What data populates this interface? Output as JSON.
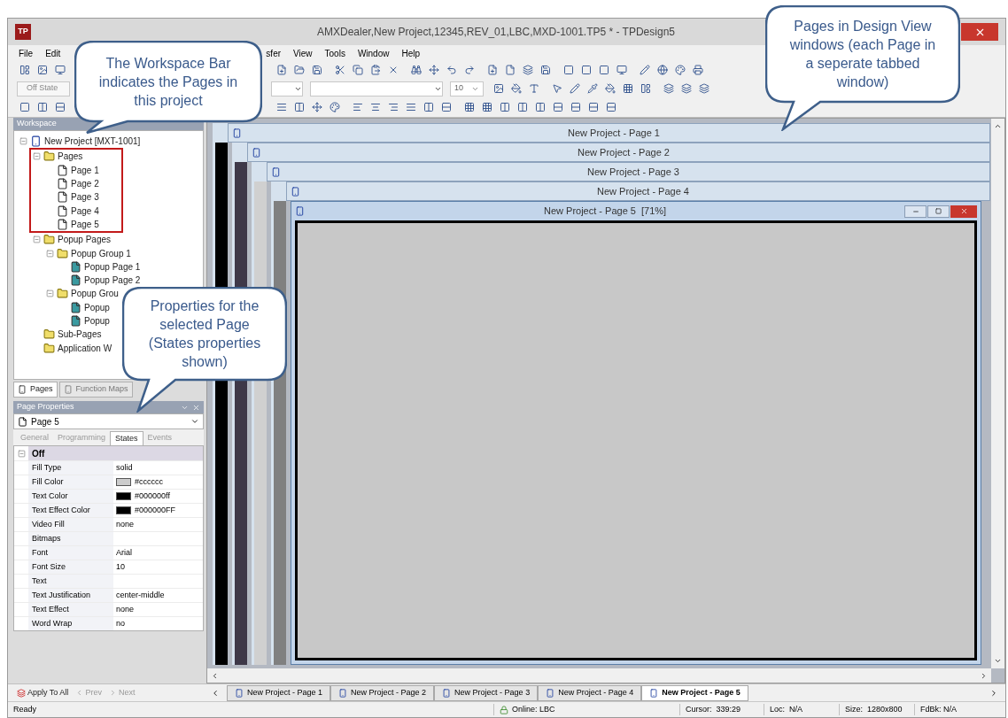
{
  "window": {
    "title": "AMXDealer,New Project,12345,REV_01,LBC,MXD-1001.TP5 * - TPDesign5",
    "logo": "TP"
  },
  "menu": [
    "File",
    "Edit",
    "sfer",
    "View",
    "Tools",
    "Window",
    "Help"
  ],
  "toolbar": {
    "state_combo": "Off State",
    "font_size": "10"
  },
  "workspace": {
    "title": "Workspace",
    "tree": [
      {
        "label": "New Project [MXT-1001]",
        "kind": "project",
        "expanded": true,
        "children": [
          {
            "label": "Pages",
            "kind": "folder",
            "expanded": true,
            "highlighted": true,
            "children": [
              {
                "label": "Page 1",
                "kind": "page"
              },
              {
                "label": "Page 2",
                "kind": "page"
              },
              {
                "label": "Page 3",
                "kind": "page"
              },
              {
                "label": "Page 4",
                "kind": "page"
              },
              {
                "label": "Page 5",
                "kind": "page"
              }
            ]
          },
          {
            "label": "Popup Pages",
            "kind": "folder",
            "expanded": true,
            "highlighted": false,
            "children": [
              {
                "label": "Popup Group 1",
                "kind": "folder",
                "expanded": true,
                "children": [
                  {
                    "label": "Popup Page 1",
                    "kind": "popup"
                  },
                  {
                    "label": "Popup Page 2",
                    "kind": "popup"
                  }
                ]
              },
              {
                "label": "Popup Grou",
                "kind": "folder",
                "expanded": true,
                "children": [
                  {
                    "label": "Popup",
                    "kind": "popup"
                  },
                  {
                    "label": "Popup",
                    "kind": "popup"
                  }
                ]
              }
            ]
          },
          {
            "label": "Sub-Pages",
            "kind": "folder",
            "highlighted": false
          },
          {
            "label": "Application W",
            "kind": "folder",
            "highlighted": false
          }
        ]
      }
    ],
    "tabs": [
      {
        "label": "Pages",
        "selected": true
      },
      {
        "label": "Function Maps",
        "selected": false
      }
    ]
  },
  "properties": {
    "title": "Page Properties",
    "selector": "Page 5",
    "tabs": [
      {
        "label": "General",
        "selected": false
      },
      {
        "label": "Programming",
        "selected": false
      },
      {
        "label": "States",
        "selected": true
      },
      {
        "label": "Events",
        "selected": false
      }
    ],
    "group": {
      "label": "Off",
      "expanded": true
    },
    "rows": [
      {
        "name": "Fill Type",
        "value": "solid"
      },
      {
        "name": "Fill Color",
        "value": "#cccccc",
        "color": "#cccccc"
      },
      {
        "name": "Text Color",
        "value": "#000000ff",
        "color": "#000000"
      },
      {
        "name": "Text Effect Color",
        "value": "#000000FF",
        "color": "#000000"
      },
      {
        "name": "Video Fill",
        "value": "none"
      },
      {
        "name": "Bitmaps"
      },
      {
        "name": "Font",
        "value": "Arial"
      },
      {
        "name": "Font Size",
        "value": "10"
      },
      {
        "name": "Text"
      },
      {
        "name": "Text Justification",
        "value": "center-middle"
      },
      {
        "name": "Text Effect",
        "value": "none"
      },
      {
        "name": "Word Wrap",
        "value": "no"
      }
    ]
  },
  "footer_buttons": [
    {
      "label": "Apply To All",
      "disabled": false
    },
    {
      "label": "Prev",
      "disabled": true
    },
    {
      "label": "Next",
      "disabled": true
    }
  ],
  "mdi_windows": [
    {
      "title": "New Project - Page 1",
      "active": false,
      "color": "#000000"
    },
    {
      "title": "New Project - Page 2",
      "active": false,
      "color": "#3e3848"
    },
    {
      "title": "New Project - Page 3",
      "active": false,
      "color": "#d0d0d0"
    },
    {
      "title": "New Project - Page 4",
      "active": false,
      "color": "#808080"
    },
    {
      "title": "New Project - Page 5  [71%]",
      "active": true,
      "color": "#c8c8c8"
    }
  ],
  "document_tabs": [
    {
      "label": "New Project - Page 1",
      "selected": false
    },
    {
      "label": "New Project - Page 2",
      "selected": false
    },
    {
      "label": "New Project - Page 3",
      "selected": false
    },
    {
      "label": "New Project - Page 4",
      "selected": false
    },
    {
      "label": "New Project - Page 5",
      "selected": true
    }
  ],
  "status_bar": {
    "ready": "Ready",
    "online": "Online: LBC",
    "cursor": "Cursor:  339:29",
    "loc": "Loc:  N/A",
    "size": "Size:  1280x800",
    "feedback": "FdBk: N/A"
  },
  "callouts": [
    {
      "text": "The Workspace Bar indicates the Pages in this project"
    },
    {
      "text": "Pages in Design View windows (each Page in a seperate tabbed window)"
    },
    {
      "text": "Properties for the selected Page (States properties shown)"
    }
  ]
}
